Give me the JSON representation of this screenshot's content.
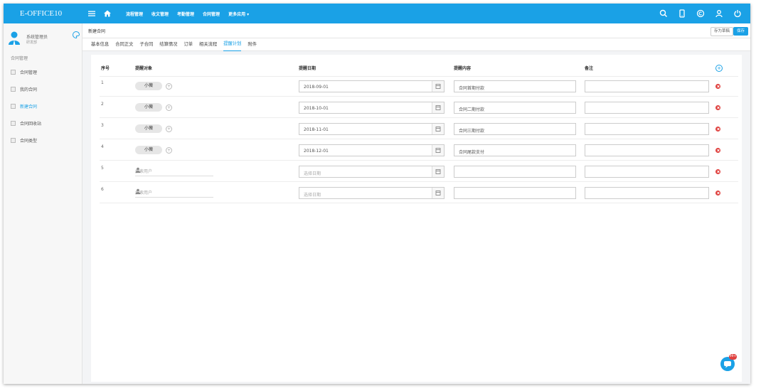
{
  "app": {
    "logo": "E-OFFICE10"
  },
  "topnav": {
    "menu": [
      "流程管理",
      "收文管理",
      "考勤管理",
      "合同管理",
      "更多应用 ▾"
    ]
  },
  "sidebar": {
    "user_name": "系统管理员",
    "user_dept": "研发部",
    "section": "合同管理",
    "items": [
      {
        "label": "合同管理",
        "active": false
      },
      {
        "label": "我的合同",
        "active": false
      },
      {
        "label": "新建合同",
        "active": true
      },
      {
        "label": "合同回收站",
        "active": false
      },
      {
        "label": "合同类型",
        "active": false
      }
    ]
  },
  "page": {
    "title": "新建合同",
    "save_draft": "存为草稿",
    "save": "保存"
  },
  "tabs": [
    {
      "label": "基本信息",
      "active": false
    },
    {
      "label": "合同正文",
      "active": false
    },
    {
      "label": "子合同",
      "active": false
    },
    {
      "label": "结算情况",
      "active": false
    },
    {
      "label": "订单",
      "active": false
    },
    {
      "label": "相关流程",
      "active": false
    },
    {
      "label": "提醒计划",
      "active": true
    },
    {
      "label": "附件",
      "active": false
    }
  ],
  "table": {
    "headers": {
      "index": "序号",
      "target": "提醒对象",
      "date": "提醒日期",
      "content": "提醒内容",
      "note": "备注"
    },
    "rows": [
      {
        "index": "1",
        "target": "小薇",
        "date": "2018-09-01",
        "content": "合同首期付款",
        "note": ""
      },
      {
        "index": "2",
        "target": "小薇",
        "date": "2018-10-01",
        "content": "合同二期付款",
        "note": ""
      },
      {
        "index": "3",
        "target": "小薇",
        "date": "2018-11-01",
        "content": "合同三期付款",
        "note": ""
      },
      {
        "index": "4",
        "target": "小薇",
        "date": "2018-12-01",
        "content": "合同尾款支付",
        "note": ""
      },
      {
        "index": "5",
        "target": "",
        "date": "",
        "content": "",
        "note": ""
      },
      {
        "index": "6",
        "target": "",
        "date": "",
        "content": "",
        "note": ""
      }
    ],
    "search_user_placeholder": "搜索用户",
    "select_date_placeholder": "选择日期"
  },
  "chat": {
    "badge": "99+"
  },
  "colors": {
    "accent": "#1aa1e6",
    "danger": "#e0413f"
  }
}
